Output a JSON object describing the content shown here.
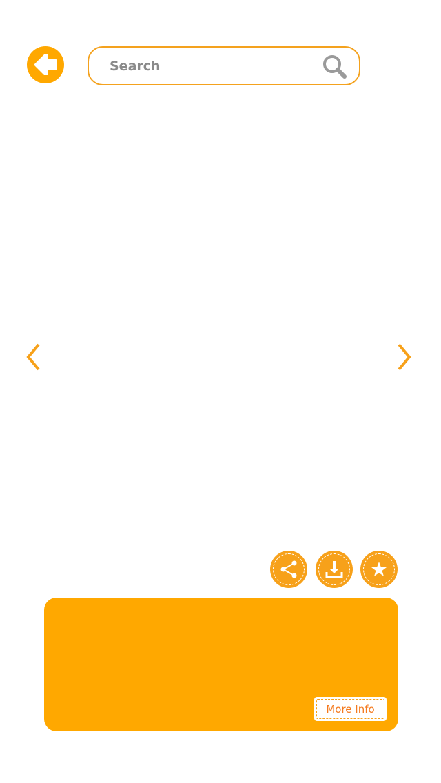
{
  "header": {
    "back_icon": "back-arrow-icon",
    "search": {
      "placeholder": "Search",
      "value": "",
      "icon": "search-icon"
    }
  },
  "gallery": {
    "prev_icon": "chevron-left-icon",
    "next_icon": "chevron-right-icon"
  },
  "actions": [
    {
      "name": "share",
      "icon": "share-icon"
    },
    {
      "name": "download",
      "icon": "download-icon"
    },
    {
      "name": "favorite",
      "icon": "star-icon"
    }
  ],
  "info_panel": {
    "more_info_label": "More Info"
  },
  "colors": {
    "accent": "#ffa800",
    "accent_border": "#f4a21e",
    "button_text": "#f47a1f",
    "search_text": "#8a8a8a",
    "background": "#ffffff"
  }
}
